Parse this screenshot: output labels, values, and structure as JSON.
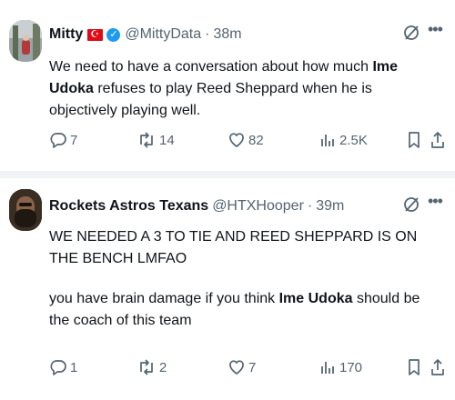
{
  "tweets": [
    {
      "name": "Mitty",
      "handle": "@MittyData",
      "dot": "·",
      "time": "38m",
      "text_runs": [
        {
          "t": "We need to have a conversation about how much "
        },
        {
          "t": "Ime Udoka",
          "b": true
        },
        {
          "t": " refuses to play Reed Sheppard when he is objectively playing well."
        }
      ],
      "replies": "7",
      "reposts": "14",
      "likes": "82",
      "views": "2.5K"
    },
    {
      "name": "Rockets Astros Texans",
      "handle": "@HTXHooper",
      "dot": "·",
      "time": "39m",
      "line1": "WE NEEDED A 3 TO TIE AND REED SHEPPARD IS ON THE BENCH LMFAO",
      "text_runs": [
        {
          "t": "you have brain damage if you think "
        },
        {
          "t": "Ime Udoka",
          "b": true
        },
        {
          "t": " should be the coach of this team"
        }
      ],
      "replies": "1",
      "reposts": "2",
      "likes": "7",
      "views": "170"
    }
  ],
  "icons": {
    "reply": "reply-icon",
    "repost": "repost-icon",
    "like": "heart-icon",
    "views": "views-icon",
    "bookmark": "bookmark-icon",
    "share": "share-icon",
    "grok": "grok-icon",
    "more": "more-icon",
    "verified": "verified-badge-icon",
    "flag": "turkey-flag-icon"
  },
  "colors": {
    "text": "#0f1419",
    "secondary": "#536471",
    "verified": "#1d9bf0",
    "flag": "#e30a17",
    "separator": "#eff3f4"
  }
}
